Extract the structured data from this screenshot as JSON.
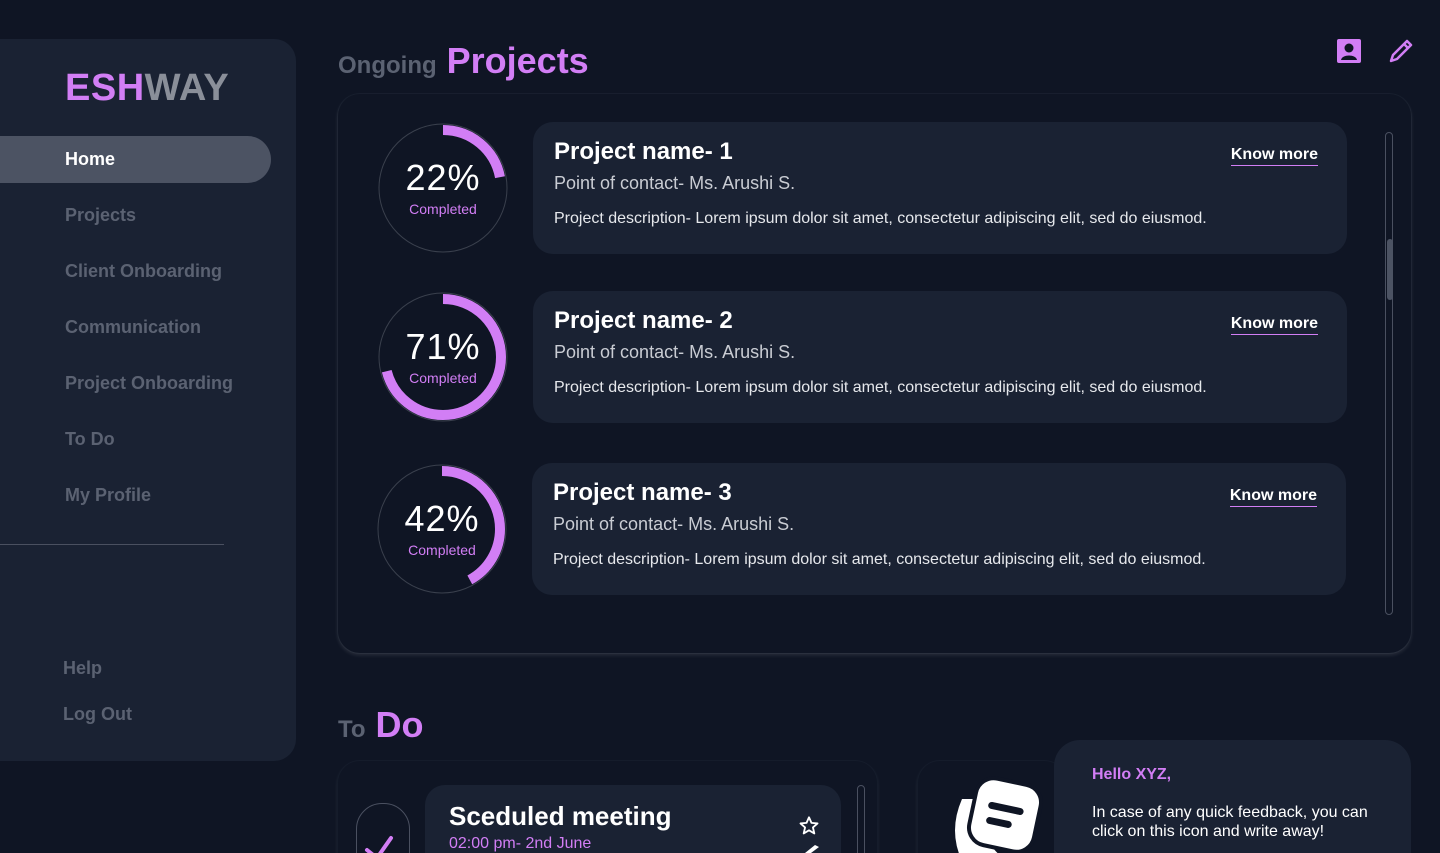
{
  "brand": {
    "part1": "ESH",
    "part2": "WAY"
  },
  "sidebar": {
    "items": [
      {
        "label": "Home"
      },
      {
        "label": "Projects"
      },
      {
        "label": "Client Onboarding"
      },
      {
        "label": "Communication"
      },
      {
        "label": "Project Onboarding"
      },
      {
        "label": "To Do"
      },
      {
        "label": "My Profile"
      }
    ],
    "help": "Help",
    "logout": "Log Out"
  },
  "projects_section": {
    "small": "Ongoing",
    "big": "Projects"
  },
  "projects": [
    {
      "percent": 22,
      "percent_label": "22%",
      "status": "Completed",
      "name": "Project name- 1",
      "contact": "Point of contact- Ms. Arushi S.",
      "description": "Project description- Lorem ipsum dolor sit amet, consectetur adipiscing elit, sed do eiusmod.",
      "link": "Know more"
    },
    {
      "percent": 71,
      "percent_label": "71%",
      "status": "Completed",
      "name": "Project name- 2",
      "contact": "Point of contact- Ms. Arushi S.",
      "description": "Project description- Lorem ipsum dolor sit amet, consectetur adipiscing elit, sed do eiusmod.",
      "link": "Know more"
    },
    {
      "percent": 42,
      "percent_label": "42%",
      "status": "Completed",
      "name": "Project name- 3",
      "contact": "Point of contact- Ms. Arushi S.",
      "description": "Project description- Lorem ipsum dolor sit amet, consectetur adipiscing elit, sed do eiusmod.",
      "link": "Know more"
    }
  ],
  "todo_section": {
    "small": "To",
    "big": "Do"
  },
  "todo": {
    "title": "Sceduled meeting",
    "time": "02:00 pm- 2nd June"
  },
  "feedback": {
    "greeting": "Hello XYZ,",
    "message": "In case of any quick feedback, you can click on this icon and write away!"
  },
  "colors": {
    "accent": "#d27ef5",
    "background": "#0f1524",
    "panel": "#1a2233",
    "muted": "#5b6272"
  },
  "icons": {
    "profile": "user-badge-icon",
    "edit": "pencil-icon",
    "star": "star-icon",
    "check": "check-icon",
    "feedback": "feedback-note-icon"
  }
}
